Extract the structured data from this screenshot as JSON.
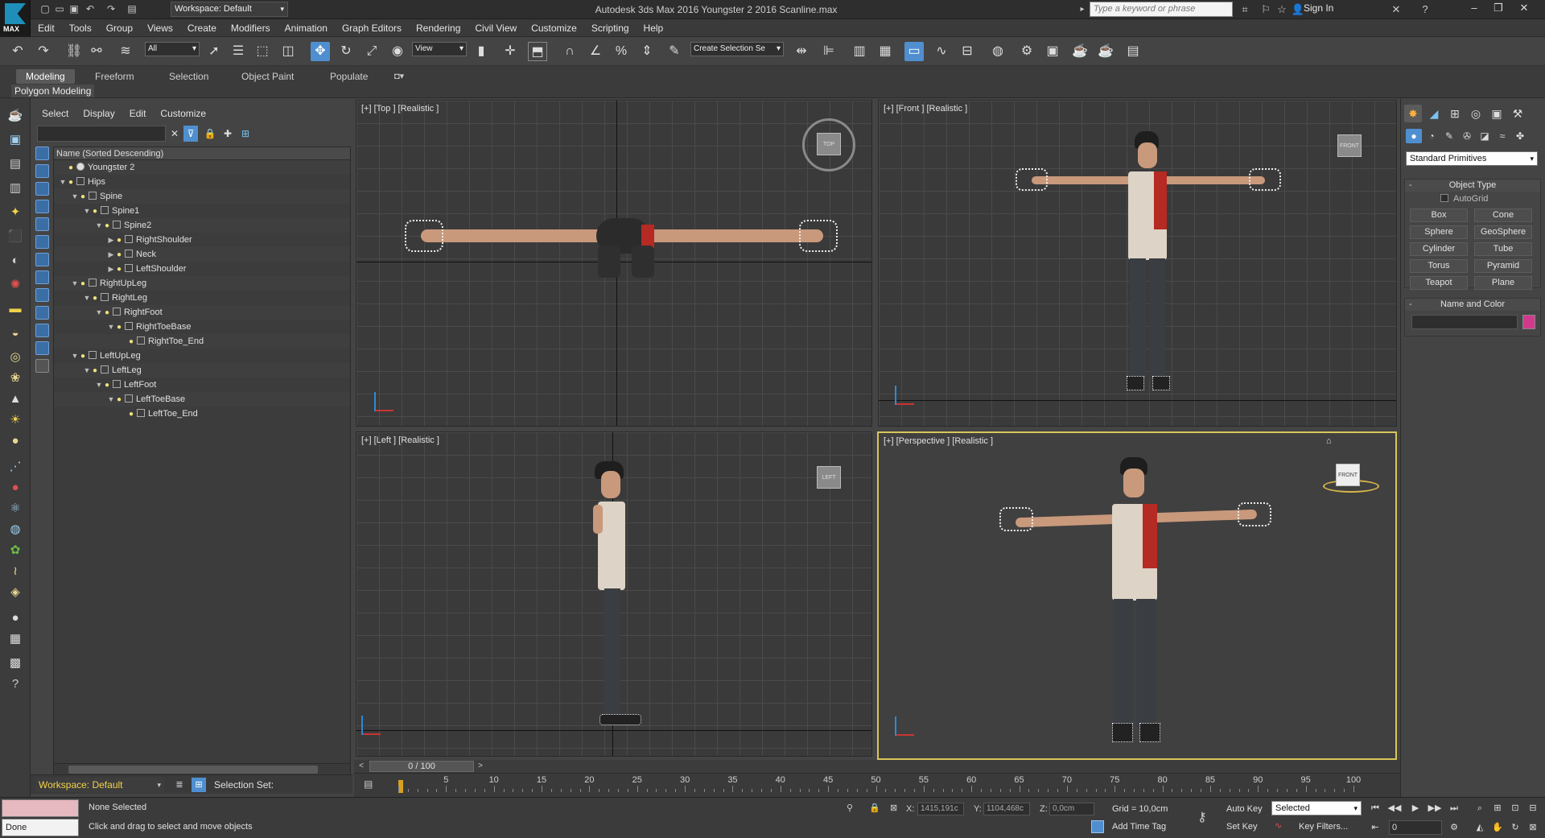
{
  "title_bar": {
    "app_title": "Autodesk 3ds Max 2016     Youngster 2 2016 Scanline.max",
    "workspace": "Workspace: Default",
    "search_placeholder": "Type a keyword or phrase",
    "sign_in": "Sign In",
    "logo_text": "MAX"
  },
  "menu": [
    "Edit",
    "Tools",
    "Group",
    "Views",
    "Create",
    "Modifiers",
    "Animation",
    "Graph Editors",
    "Rendering",
    "Civil View",
    "Customize",
    "Scripting",
    "Help"
  ],
  "main_toolbar": {
    "selection_filter": "All",
    "reference_coord": "View",
    "named_selection": "Create Selection Se"
  },
  "ribbon": {
    "tabs": [
      "Modeling",
      "Freeform",
      "Selection",
      "Object Paint",
      "Populate"
    ],
    "active_tab": "Modeling",
    "panel_label": "Polygon Modeling"
  },
  "scene_explorer": {
    "menu": [
      "Select",
      "Display",
      "Edit",
      "Customize"
    ],
    "column_header": "Name (Sorted Descending)",
    "rows": [
      {
        "name": "Youngster 2",
        "indent": 0,
        "expander": "",
        "icon": "teapot"
      },
      {
        "name": "Hips",
        "indent": 0,
        "expander": "▼",
        "icon": "bone"
      },
      {
        "name": "Spine",
        "indent": 1,
        "expander": "▼",
        "icon": "bone"
      },
      {
        "name": "Spine1",
        "indent": 2,
        "expander": "▼",
        "icon": "bone"
      },
      {
        "name": "Spine2",
        "indent": 3,
        "expander": "▼",
        "icon": "bone"
      },
      {
        "name": "RightShoulder",
        "indent": 4,
        "expander": "▶",
        "icon": "bone"
      },
      {
        "name": "Neck",
        "indent": 4,
        "expander": "▶",
        "icon": "bone"
      },
      {
        "name": "LeftShoulder",
        "indent": 4,
        "expander": "▶",
        "icon": "bone"
      },
      {
        "name": "RightUpLeg",
        "indent": 1,
        "expander": "▼",
        "icon": "bone"
      },
      {
        "name": "RightLeg",
        "indent": 2,
        "expander": "▼",
        "icon": "bone"
      },
      {
        "name": "RightFoot",
        "indent": 3,
        "expander": "▼",
        "icon": "bone"
      },
      {
        "name": "RightToeBase",
        "indent": 4,
        "expander": "▼",
        "icon": "bone"
      },
      {
        "name": "RightToe_End",
        "indent": 5,
        "expander": "",
        "icon": "bone"
      },
      {
        "name": "LeftUpLeg",
        "indent": 1,
        "expander": "▼",
        "icon": "bone"
      },
      {
        "name": "LeftLeg",
        "indent": 2,
        "expander": "▼",
        "icon": "bone"
      },
      {
        "name": "LeftFoot",
        "indent": 3,
        "expander": "▼",
        "icon": "bone"
      },
      {
        "name": "LeftToeBase",
        "indent": 4,
        "expander": "▼",
        "icon": "bone"
      },
      {
        "name": "LeftToe_End",
        "indent": 5,
        "expander": "",
        "icon": "bone"
      }
    ],
    "workspace_bottom": "Workspace: Default",
    "selection_set_label": "Selection Set:"
  },
  "viewports": {
    "top": {
      "label": "[+] [Top ] [Realistic ]",
      "navcube": "TOP"
    },
    "front": {
      "label": "[+] [Front ] [Realistic ]",
      "navcube": "FRONT"
    },
    "left": {
      "label": "[+] [Left ] [Realistic ]",
      "navcube": "LEFT"
    },
    "perspective": {
      "label": "[+] [Perspective ] [Realistic ]",
      "navcube": "FRONT",
      "active": true
    }
  },
  "command_panel": {
    "dropdown": "Standard Primitives",
    "object_type_title": "Object Type",
    "autogrid": "AutoGrid",
    "buttons": [
      "Box",
      "Cone",
      "Sphere",
      "GeoSphere",
      "Cylinder",
      "Tube",
      "Torus",
      "Pyramid",
      "Teapot",
      "Plane"
    ],
    "name_color_title": "Name and Color",
    "color": "#d13a8b"
  },
  "timeline": {
    "slider_text": "0 / 100",
    "ticks": [
      5,
      10,
      15,
      20,
      25,
      30,
      35,
      40,
      45,
      50,
      55,
      60,
      65,
      70,
      75,
      80,
      85,
      90,
      95,
      100
    ]
  },
  "status_bar": {
    "mode": "Done",
    "selection": "None Selected",
    "prompt": "Click and drag to select and move objects",
    "x_label": "X:",
    "x_value": "1415,191c",
    "y_label": "Y:",
    "y_value": "1104,468c",
    "z_label": "Z:",
    "z_value": "0,0cm",
    "grid": "Grid = 10,0cm",
    "add_time_tag": "Add Time Tag",
    "auto_key": "Auto Key",
    "set_key": "Set Key",
    "key_mode": "Selected",
    "key_filters": "Key Filters...",
    "frame": "0"
  }
}
